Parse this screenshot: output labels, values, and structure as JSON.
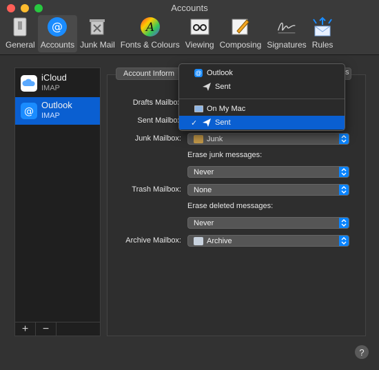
{
  "window": {
    "title": "Accounts"
  },
  "toolbar": {
    "items": [
      {
        "label": "General",
        "icon": "general-icon"
      },
      {
        "label": "Accounts",
        "icon": "accounts-icon"
      },
      {
        "label": "Junk Mail",
        "icon": "junk-mail-icon"
      },
      {
        "label": "Fonts & Colours",
        "icon": "fonts-colours-icon"
      },
      {
        "label": "Viewing",
        "icon": "viewing-icon"
      },
      {
        "label": "Composing",
        "icon": "composing-icon"
      },
      {
        "label": "Signatures",
        "icon": "signatures-icon"
      },
      {
        "label": "Rules",
        "icon": "rules-icon"
      }
    ],
    "active": "Accounts"
  },
  "sidebar": {
    "accounts": [
      {
        "name": "iCloud",
        "kind": "IMAP",
        "icon": "icloud-icon"
      },
      {
        "name": "Outlook",
        "kind": "IMAP",
        "icon": "at-sign-icon"
      }
    ],
    "selected": "Outlook",
    "add_label": "+",
    "remove_label": "−"
  },
  "tabs": {
    "first_label": "Account Inform",
    "last_fragment": "s"
  },
  "form": {
    "drafts_label": "Drafts Mailbox",
    "sent_label": "Sent Mailbox",
    "junk_label": "Junk Mailbox:",
    "junk_value": "Junk",
    "erase_junk_label": "Erase junk messages:",
    "erase_junk_value": "Never",
    "trash_label": "Trash Mailbox:",
    "trash_value": "None",
    "erase_deleted_label": "Erase deleted messages:",
    "erase_deleted_value": "Never",
    "archive_label": "Archive Mailbox:",
    "archive_value": "Archive"
  },
  "menu": {
    "group1_header": "Outlook",
    "group1_item": "Sent",
    "group2_header": "On My Mac",
    "group2_item": "Sent",
    "checkmark": "✓"
  },
  "help": {
    "label": "?"
  },
  "colors": {
    "accent": "#0a5fd1",
    "popup_arrow": "#0a84ff"
  }
}
